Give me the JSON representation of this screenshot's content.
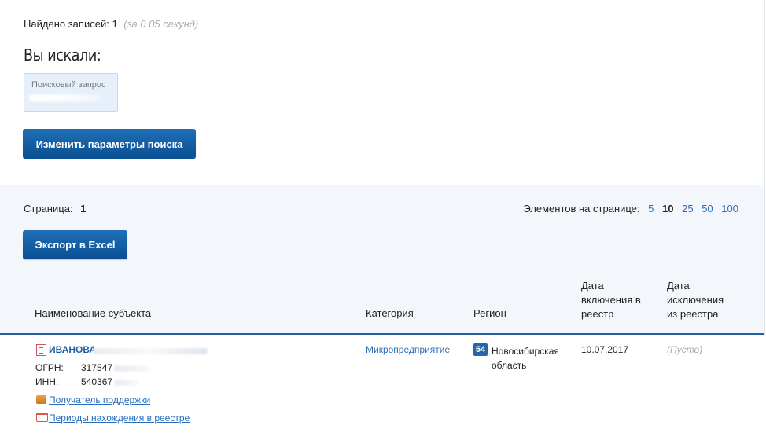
{
  "summary": {
    "found_label": "Найдено записей:",
    "found_count": "1",
    "time_text": "(за 0.05 секунд)"
  },
  "search": {
    "heading": "Вы искали:",
    "query_label": "Поисковый запрос",
    "change_button": "Изменить параметры поиска"
  },
  "pagination": {
    "page_label": "Страница:",
    "page_value": "1",
    "per_page_label": "Элементов на странице:",
    "per_page_options": [
      "5",
      "10",
      "25",
      "50",
      "100"
    ],
    "per_page_selected": "10"
  },
  "export_button": "Экспорт в Excel",
  "table": {
    "headers": {
      "name": "Наименование субъекта",
      "category": "Категория",
      "region": "Регион",
      "date_in_1": "Дата",
      "date_in_2": "включения в",
      "date_in_3": "реестр",
      "date_out_1": "Дата",
      "date_out_2": "исключения",
      "date_out_3": "из реестра"
    },
    "row": {
      "name": "ИВАНОВА",
      "ogrn_label": "ОГРН:",
      "ogrn_value": "317547",
      "inn_label": "ИНН:",
      "inn_value": "540367",
      "support_link": "Получатель поддержки",
      "periods_link": "Периоды нахождения в реестре",
      "category": "Микропредприятие",
      "region_code": "54",
      "region_name_1": "Новосибирская",
      "region_name_2": "область",
      "date_in": "10.07.2017",
      "date_out": "(Пусто)"
    }
  },
  "colors": {
    "accent": "#1f5f9e",
    "link": "#2a6ebb",
    "button": "#0a4f92"
  }
}
